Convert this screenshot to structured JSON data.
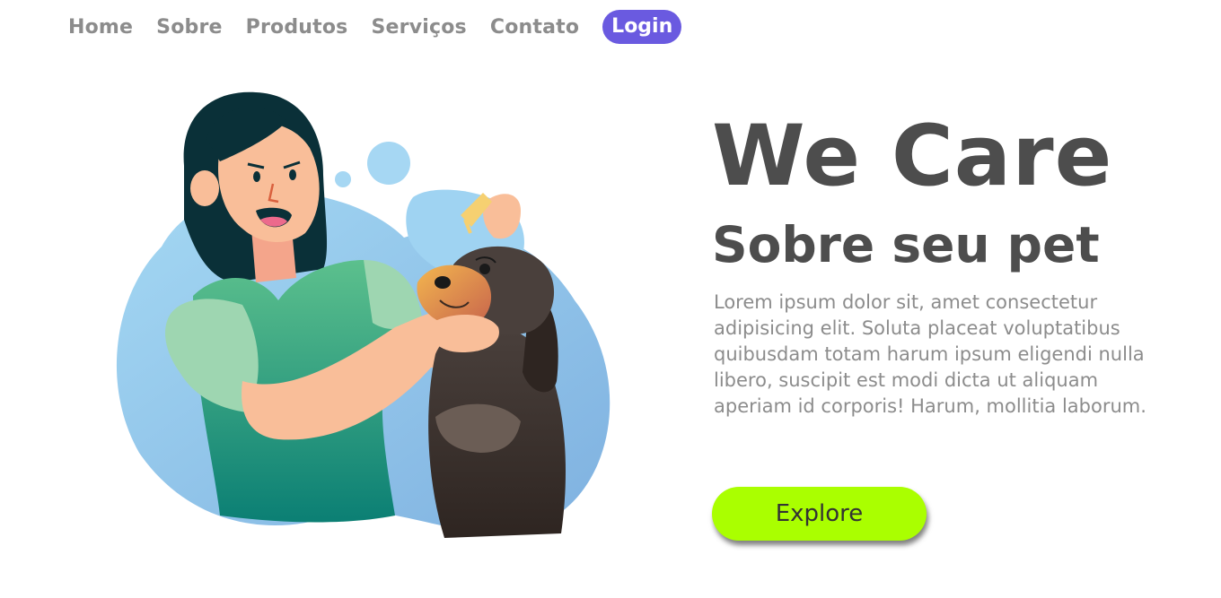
{
  "nav": {
    "items": [
      {
        "label": "Home"
      },
      {
        "label": "Sobre"
      },
      {
        "label": "Produtos"
      },
      {
        "label": "Serviços"
      },
      {
        "label": "Contato"
      }
    ],
    "login_label": "Login"
  },
  "hero": {
    "title": "We Care",
    "subtitle": "Sobre seu pet",
    "text": "Lorem ipsum dolor sit, amet consectetur adipisicing elit. Soluta placeat voluptatibus quibusdam totam harum ipsum eligendi nulla libero, suscipit est modi dicta ut aliquam aperiam id corporis! Harum, mollitia laborum.",
    "explore_label": "Explore"
  },
  "colors": {
    "login_bg": "#6a5ae0",
    "explore_bg": "#aaff00",
    "heading": "#4d4d4d",
    "body_text": "#8c8c8c",
    "nav_text": "#8c8c8c"
  }
}
